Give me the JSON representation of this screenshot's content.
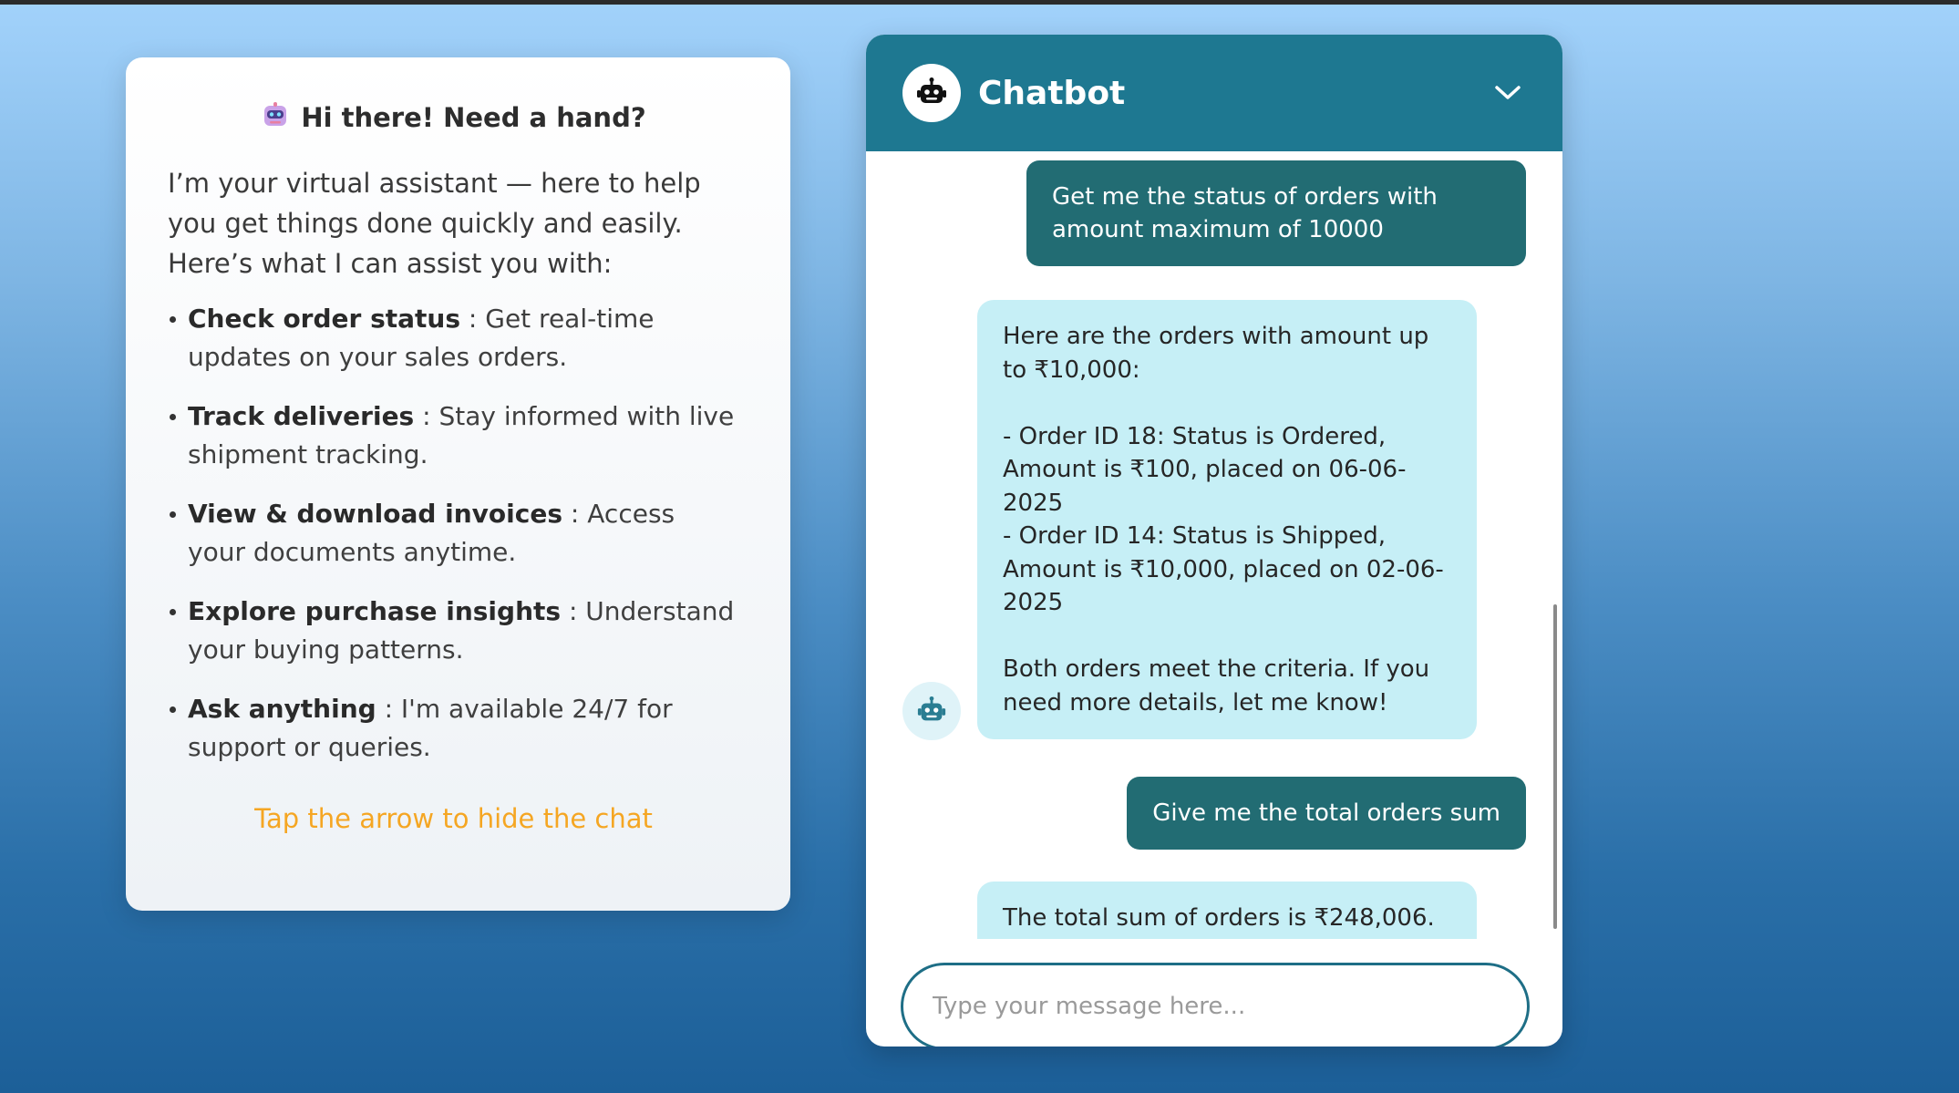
{
  "colors": {
    "header_bg": "#1e7891",
    "user_bubble": "#226c73",
    "bot_bubble": "#c6eff6",
    "hint": "#f5a623"
  },
  "info": {
    "title_icon": "robot-emoji-icon",
    "title": "Hi there! Need a hand?",
    "intro": "I’m your virtual assistant — here to help you get things done quickly and easily. Here’s what I can assist you with:",
    "features": [
      {
        "label": "Check order status",
        "desc": " : Get real-time updates on your sales orders."
      },
      {
        "label": "Track deliveries",
        "desc": " : Stay informed with live shipment tracking."
      },
      {
        "label": "View & download invoices",
        "desc": " : Access your documents anytime."
      },
      {
        "label": "Explore purchase insights",
        "desc": " : Understand your buying patterns."
      },
      {
        "label": "Ask anything",
        "desc": " : I'm available 24/7 for support or queries."
      }
    ],
    "hint": "Tap the arrow to hide the chat"
  },
  "chat": {
    "title": "Chatbot",
    "header_icon": "robot-icon",
    "collapse_icon": "chevron-down-icon",
    "messages": [
      {
        "role": "user",
        "text": "Get me the status of orders with amount maximum of 10000"
      },
      {
        "role": "bot",
        "text": "Here are the orders with amount up to ₹10,000:\n\n- Order ID 18: Status is Ordered, Amount is ₹100, placed on 06-06-2025\n- Order ID 14: Status is Shipped, Amount is ₹10,000, placed on 02-06-2025\n\nBoth orders meet the criteria. If you need more details, let me know!"
      },
      {
        "role": "user",
        "text": "Give me the total orders sum"
      },
      {
        "role": "bot",
        "text": "The total sum of orders is ₹248,006."
      }
    ],
    "input": {
      "placeholder": "Type your message here...",
      "value": ""
    }
  }
}
